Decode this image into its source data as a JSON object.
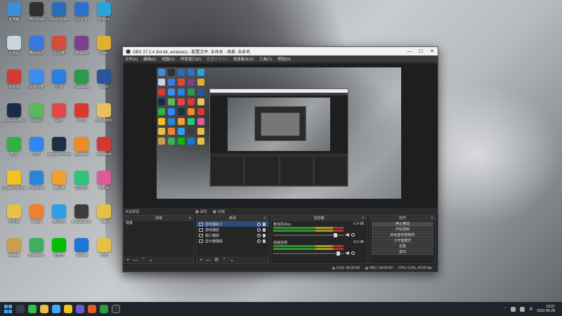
{
  "desktop": {
    "icons": [
      {
        "label": "此电脑",
        "color": "#3c8fd8"
      },
      {
        "label": "OBS Studio",
        "color": "#303030"
      },
      {
        "label": "Visual Studio",
        "color": "#2b6cb8"
      },
      {
        "label": "EV录屏",
        "color": "#2d70c9"
      },
      {
        "label": "PicPick",
        "color": "#2ba4d9"
      },
      {
        "label": "回收站",
        "color": "#c9d4de"
      },
      {
        "label": "腾讯会议",
        "color": "#3a78e0"
      },
      {
        "label": "工具箱",
        "color": "#d84a3a"
      },
      {
        "label": "WinRAR",
        "color": "#7b3f8c"
      },
      {
        "label": "Tools",
        "color": "#e0b030"
      },
      {
        "label": "网易云",
        "color": "#d43c33"
      },
      {
        "label": "百度网盘",
        "color": "#3a8ef0"
      },
      {
        "label": "迅雷",
        "color": "#2a7fe0"
      },
      {
        "label": "Camtasia",
        "color": "#2d9a48"
      },
      {
        "label": "Word",
        "color": "#2a5699"
      },
      {
        "label": "Adobe Audition",
        "color": "#1c2a4a"
      },
      {
        "label": "Get Go",
        "color": "#5cb85c"
      },
      {
        "label": "百度",
        "color": "#e04848"
      },
      {
        "label": "WPS",
        "color": "#d93a30"
      },
      {
        "label": "IMG_8800",
        "color": "#e8c060"
      },
      {
        "label": "微信",
        "color": "#32b043"
      },
      {
        "label": "钉钉",
        "color": "#2f86f6"
      },
      {
        "label": "League of Legends",
        "color": "#1c3046"
      },
      {
        "label": "Illustrator",
        "color": "#f08a24"
      },
      {
        "label": "Autodesk",
        "color": "#d33a2f"
      },
      {
        "label": "Google Chrome",
        "color": "#f4c21f"
      },
      {
        "label": "One Drive",
        "color": "#2b84d6"
      },
      {
        "label": "编程猫",
        "color": "#f0a030"
      },
      {
        "label": "QQ音乐",
        "color": "#31c27c"
      },
      {
        "label": "爱剪辑",
        "color": "#e05a9a"
      },
      {
        "label": "文件夹",
        "color": "#e9c046"
      },
      {
        "label": "xampp",
        "color": "#f08030"
      },
      {
        "label": "腾讯QQ",
        "color": "#2aa0e8"
      },
      {
        "label": "ImageGlass",
        "color": "#3c3c3c"
      },
      {
        "label": "sqlit",
        "color": "#e9c046"
      },
      {
        "label": "league",
        "color": "#c8a050"
      },
      {
        "label": "HBuilderX",
        "color": "#3cb060"
      },
      {
        "label": "爱奇艺",
        "color": "#00be06"
      },
      {
        "label": "Tencent",
        "color": "#1f74d8"
      },
      {
        "label": "新建",
        "color": "#e9c046"
      }
    ]
  },
  "obs": {
    "title": "OBS 27.2.4 (64-bit, windows) - 配置文件: 未命名 - 场景: 未命名",
    "win_controls": {
      "minimize": "—",
      "maximize": "☐",
      "close": "✕"
    },
    "menu": [
      "文件(F)",
      "编辑(E)",
      "视图(V)",
      "停靠窗口(D)",
      "配置文件(P)",
      "场景集合(S)",
      "工具(T)",
      "帮助(H)"
    ],
    "scene_tabs": {
      "no_source": "未选择源",
      "filters": "属性",
      "properties": "滤镜"
    },
    "docks": {
      "scenes": {
        "title": "场景",
        "items": [
          "场景"
        ]
      },
      "sources": {
        "title": "来源",
        "items": [
          "游戏捕获 2",
          "游戏捕获",
          "窗口捕获",
          "显示器捕获"
        ]
      },
      "mixer": {
        "title": "混音器",
        "channels": [
          {
            "name": "麦克风/Aux",
            "db": "-1.4 dB",
            "level": 0.9
          },
          {
            "name": "桌面音频",
            "db": "0.0 dB",
            "level": 0.95
          }
        ]
      },
      "controls": {
        "title": "控件",
        "buttons": [
          "停止推流",
          "开始录制",
          "启动虚拟摄像机",
          "工作室模式",
          "设置",
          "退出"
        ]
      }
    },
    "footer_glyphs": {
      "add": "+",
      "remove": "—",
      "up": "⌃",
      "down": "⌄",
      "gear": "⚙"
    },
    "status": {
      "dropped": "LIVE: 00:00:00",
      "rec": "REC: 00:00:00",
      "cpu": "CPU: 0.3%, 30.00 fps"
    }
  },
  "taskbar": {
    "time": "23:07",
    "date": "2022-06-28",
    "tray_text": "中"
  }
}
